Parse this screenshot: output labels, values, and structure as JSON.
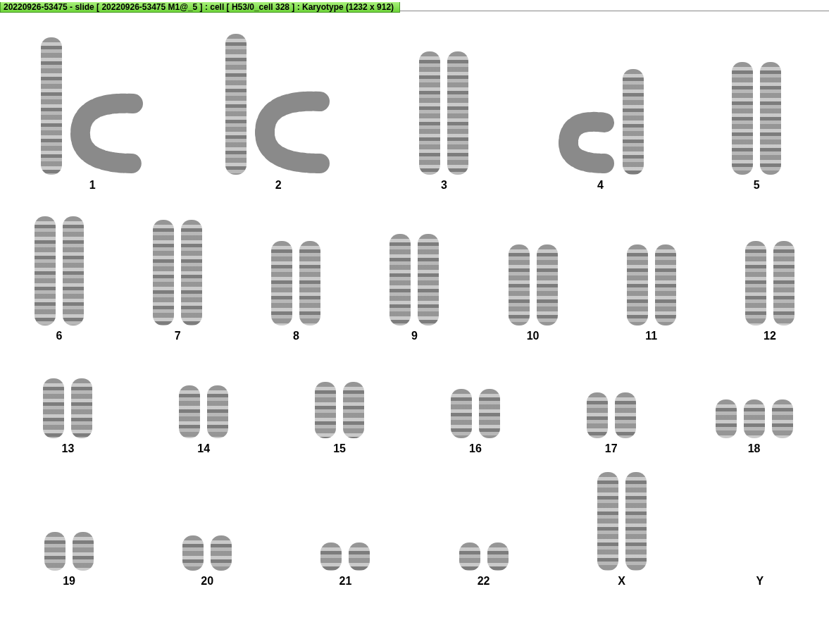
{
  "window": {
    "title": "20220926-53475 - slide [ 20220926-53475 M1@_5 ] : cell [ H53/0_cell 328 ] : Karyotype  (1232 x 912)"
  },
  "rows": [
    {
      "groups": [
        {
          "label": "1",
          "chromosomes": [
            {
              "kind": "straight"
            },
            {
              "kind": "curved"
            }
          ]
        },
        {
          "label": "2",
          "chromosomes": [
            {
              "kind": "straight"
            },
            {
              "kind": "curved"
            }
          ]
        },
        {
          "label": "3",
          "chromosomes": [
            {
              "kind": "straight"
            },
            {
              "kind": "straight"
            }
          ]
        },
        {
          "label": "4",
          "chromosomes": [
            {
              "kind": "curved"
            },
            {
              "kind": "straight"
            }
          ]
        },
        {
          "label": "5",
          "chromosomes": [
            {
              "kind": "straight"
            },
            {
              "kind": "straight"
            }
          ]
        }
      ]
    },
    {
      "groups": [
        {
          "label": "6",
          "chromosomes": [
            {
              "kind": "straight"
            },
            {
              "kind": "straight"
            }
          ]
        },
        {
          "label": "7",
          "chromosomes": [
            {
              "kind": "straight"
            },
            {
              "kind": "straight"
            }
          ]
        },
        {
          "label": "8",
          "chromosomes": [
            {
              "kind": "straight"
            },
            {
              "kind": "straight"
            }
          ]
        },
        {
          "label": "9",
          "chromosomes": [
            {
              "kind": "straight"
            },
            {
              "kind": "straight"
            }
          ]
        },
        {
          "label": "10",
          "chromosomes": [
            {
              "kind": "straight"
            },
            {
              "kind": "straight"
            }
          ]
        },
        {
          "label": "11",
          "chromosomes": [
            {
              "kind": "straight"
            },
            {
              "kind": "straight"
            }
          ]
        },
        {
          "label": "12",
          "chromosomes": [
            {
              "kind": "straight"
            },
            {
              "kind": "straight"
            }
          ]
        }
      ]
    },
    {
      "groups": [
        {
          "label": "13",
          "chromosomes": [
            {
              "kind": "straight"
            },
            {
              "kind": "straight"
            }
          ]
        },
        {
          "label": "14",
          "chromosomes": [
            {
              "kind": "straight"
            },
            {
              "kind": "straight"
            }
          ]
        },
        {
          "label": "15",
          "chromosomes": [
            {
              "kind": "straight"
            },
            {
              "kind": "straight"
            }
          ]
        },
        {
          "label": "16",
          "chromosomes": [
            {
              "kind": "straight"
            },
            {
              "kind": "straight"
            }
          ]
        },
        {
          "label": "17",
          "chromosomes": [
            {
              "kind": "straight"
            },
            {
              "kind": "straight"
            }
          ]
        },
        {
          "label": "18",
          "chromosomes": [
            {
              "kind": "straight"
            },
            {
              "kind": "straight"
            },
            {
              "kind": "straight"
            }
          ]
        }
      ]
    },
    {
      "groups": [
        {
          "label": "19",
          "chromosomes": [
            {
              "kind": "straight"
            },
            {
              "kind": "straight"
            }
          ]
        },
        {
          "label": "20",
          "chromosomes": [
            {
              "kind": "straight"
            },
            {
              "kind": "straight"
            }
          ]
        },
        {
          "label": "21",
          "chromosomes": [
            {
              "kind": "straight"
            },
            {
              "kind": "straight"
            }
          ]
        },
        {
          "label": "22",
          "chromosomes": [
            {
              "kind": "straight"
            },
            {
              "kind": "straight"
            }
          ]
        },
        {
          "label": "X",
          "chromosomes": [
            {
              "kind": "straight"
            },
            {
              "kind": "straight"
            }
          ]
        },
        {
          "label": "Y"
        }
      ]
    }
  ]
}
